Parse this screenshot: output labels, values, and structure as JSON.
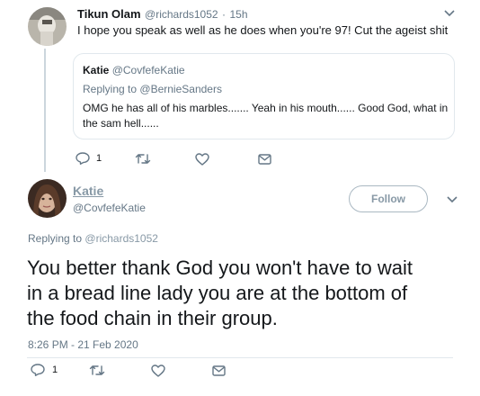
{
  "reply_tweet": {
    "author_name": "Tikun Olam",
    "author_handle": "@richards1052",
    "separator": "·",
    "time": "15h",
    "text": "I hope you speak as well as he does when you're 97! Cut the ageist shit",
    "quoted": {
      "author_name": "Katie",
      "author_handle": "@CovfefeKatie",
      "replying_label": "Replying to",
      "replying_to": "@BernieSanders",
      "text_line1": "OMG he has all of his marbles....... Yeah in his mouth...... Good God, what in",
      "text_line2": "the sam hell......"
    },
    "actions": {
      "reply_count": "1"
    }
  },
  "main_tweet": {
    "author_name": "Katie",
    "author_handle": "@CovfefeKatie",
    "follow_label": "Follow",
    "replying_label": "Replying to",
    "replying_to": "@richards1052",
    "text_line1": "You better thank God you won't have to wait",
    "text_line2": "in a bread line lady you are at the bottom of",
    "text_line3": "the food chain in their group.",
    "timestamp": "8:26 PM - 21 Feb 2020",
    "actions": {
      "reply_count": "1"
    }
  },
  "colors": {
    "accent": "#1da1f2",
    "muted": "#657786",
    "border": "#e1e8ed"
  },
  "icons": [
    "reply-icon",
    "retweet-icon",
    "like-icon",
    "direct-message-icon",
    "chevron-down-icon"
  ]
}
